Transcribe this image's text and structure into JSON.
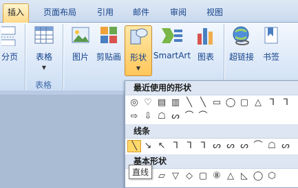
{
  "tabs": [
    {
      "label": "插入",
      "active": true
    },
    {
      "label": "页面布局"
    },
    {
      "label": "引用"
    },
    {
      "label": "邮件"
    },
    {
      "label": "审阅"
    },
    {
      "label": "视图"
    }
  ],
  "ribbon": {
    "buttons": {
      "page_break": "分页",
      "table": "表格",
      "picture": "图片",
      "clipart": "剪贴画",
      "shapes": "形状",
      "smartart": "SmartArt",
      "chart": "图表",
      "hyperlink": "超链接",
      "bookmark": "书签"
    },
    "group_labels": {
      "tables": "表格"
    }
  },
  "shapes_gallery": {
    "recent_header": "最近使用的形状",
    "recent_row1": [
      "◎",
      "♡",
      "▤",
      "▥",
      "╲",
      "╲",
      "▭",
      "◯",
      "▢",
      "△",
      "ᒣ",
      "ᒣ"
    ],
    "recent_row2": [
      "⇨",
      "⇩",
      "☖",
      "ᔕ",
      "⌒",
      "⌒"
    ],
    "lines_header": "线条",
    "lines_row": [
      "╲",
      "↘",
      "↖",
      "ᒣ",
      "ᒣ",
      "ᒣ",
      "ᔕ",
      "ᔕ",
      "ᔕ",
      "⌒",
      "☖",
      "ᔕ"
    ],
    "basic_header": "基本形状",
    "basic_row": [
      "▭",
      "▭",
      "▱",
      "▽",
      "◇",
      "▢",
      "⑧",
      "△",
      "◺",
      "◯",
      "⬡"
    ]
  },
  "tooltip": "直线",
  "colors": {
    "accent": "#ffc65a",
    "ribbon": "#dde9f8",
    "text": "#15428b"
  }
}
